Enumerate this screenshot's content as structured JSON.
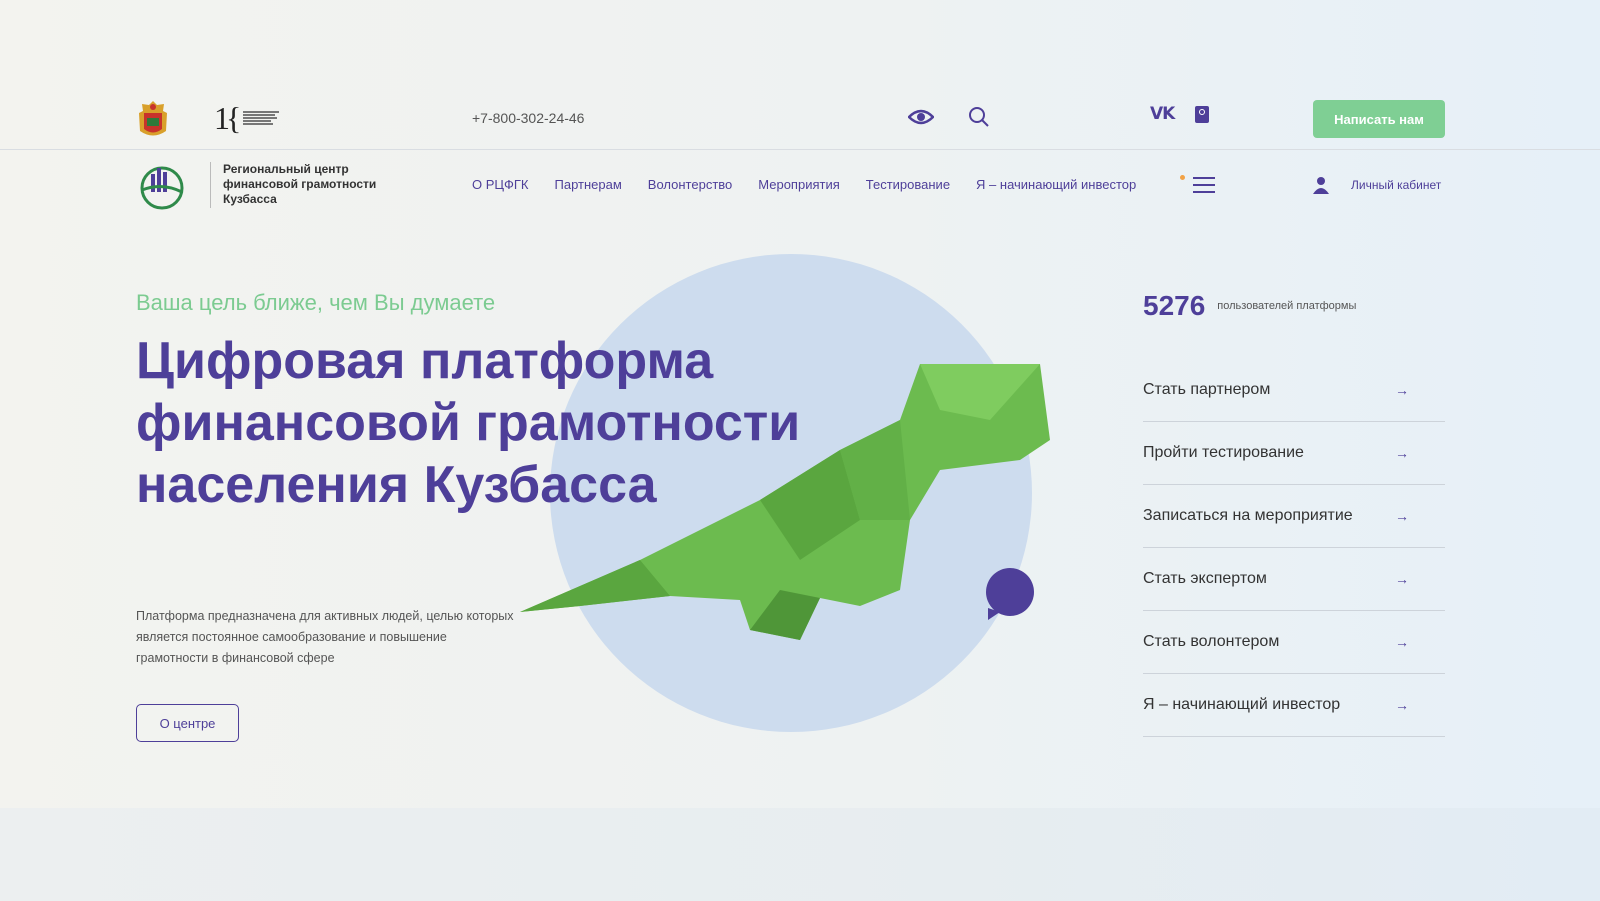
{
  "topbar": {
    "phone": "+7-800-302-24-46",
    "write_label": "Написать нам",
    "vk_text": "VK"
  },
  "brand": {
    "name": "Региональный центр финансовой грамотности Кузбасса"
  },
  "nav": {
    "items": [
      "О РЦФГК",
      "Партнерам",
      "Волонтерство",
      "Мероприятия",
      "Тестирование",
      "Я – начинающий инвестор"
    ],
    "cabinet": "Личный кабинет"
  },
  "hero": {
    "tagline": "Ваша цель ближе, чем Вы думаете",
    "title": "Цифровая платформа финансовой грамотности населения Кузбасса",
    "description": "Платформа предназначена для активных людей, целью которых является постоянное самообразование и повышение грамотности в финансовой сфере",
    "about_label": "О центре"
  },
  "stats": {
    "count": "5276",
    "label": "пользователей платформы"
  },
  "actions": [
    {
      "label": "Стать партнером"
    },
    {
      "label": "Пройти тестирование"
    },
    {
      "label": "Записаться на мероприятие"
    },
    {
      "label": "Стать экспертом"
    },
    {
      "label": "Стать волонтером"
    },
    {
      "label": "Я – начинающий инвестор"
    }
  ],
  "colors": {
    "brand": "#4e3f99",
    "accent_green": "#7fcf94",
    "circle": "#cddcee",
    "dino_green": "#6cbb4f"
  },
  "icons": [
    "coat-of-arms-icon",
    "ministry-logo-icon",
    "eye-icon",
    "search-icon",
    "vk-icon",
    "ok-icon",
    "burger-icon",
    "user-icon",
    "arrow-right-icon",
    "chat-bubble-icon"
  ]
}
